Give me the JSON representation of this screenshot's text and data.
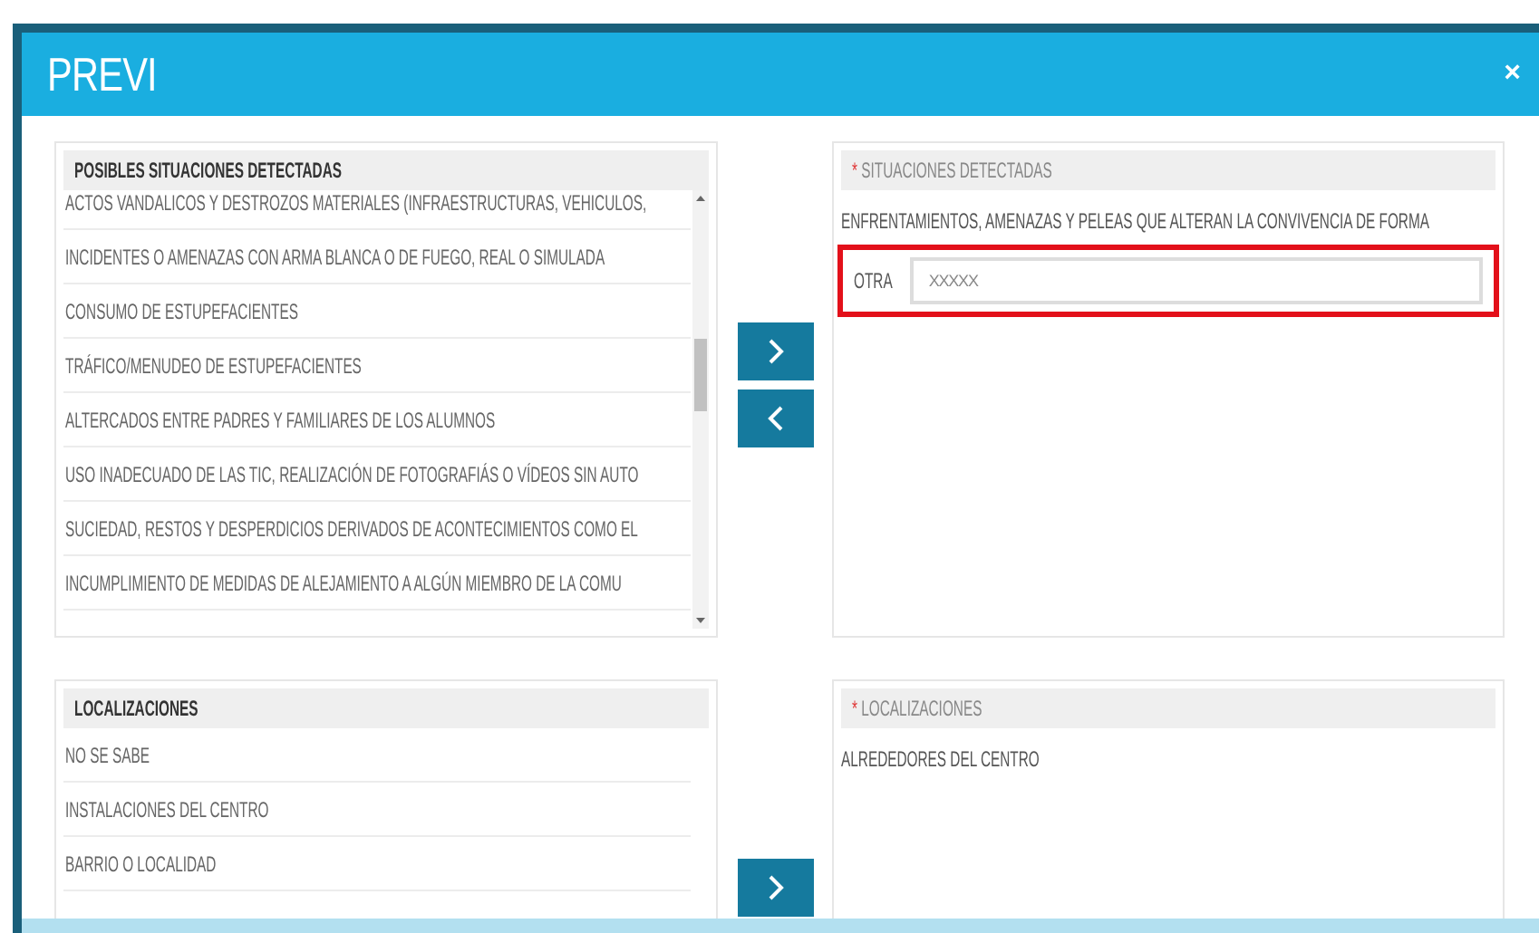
{
  "dialog": {
    "title": "PREVI",
    "close": "×"
  },
  "sections": [
    {
      "available": {
        "header": "POSIBLES SITUACIONES DETECTADAS",
        "scrollable": true,
        "items": [
          "ACTOS VANDALICOS Y DESTROZOS MATERIALES (INFRAESTRUCTURAS, VEHICULOS,",
          "INCIDENTES O AMENAZAS CON ARMA BLANCA O DE FUEGO, REAL O SIMULADA",
          "CONSUMO DE ESTUPEFACIENTES",
          "TRÁFICO/MENUDEO DE ESTUPEFACIENTES",
          "ALTERCADOS ENTRE PADRES Y FAMILIARES DE LOS ALUMNOS",
          "USO INADECUADO DE LAS TIC, REALIZACIÓN DE FOTOGRAFIÁS O VÍDEOS SIN AUTO",
          "SUCIEDAD, RESTOS Y DESPERDICIOS DERIVADOS DE ACONTECIMIENTOS COMO EL",
          "INCUMPLIMIENTO DE MEDIDAS DE ALEJAMIENTO A ALGÚN MIEMBRO DE LA COMU"
        ]
      },
      "buttons": [
        {
          "kind": "add"
        },
        {
          "kind": "remove"
        }
      ],
      "chosen": {
        "header": "SITUACIONES DETECTADAS",
        "required_mark": "*",
        "items": [
          "ENFRENTAMIENTOS, AMENAZAS Y PELEAS QUE ALTERAN LA CONVIVENCIA DE FORMA"
        ],
        "other": {
          "label": "OTRA",
          "value": "XXXXX",
          "highlighted": true
        }
      }
    },
    {
      "available": {
        "header": "LOCALIZACIONES",
        "scrollable": false,
        "items": [
          "NO SE SABE",
          "INSTALACIONES DEL CENTRO",
          "BARRIO O LOCALIDAD"
        ]
      },
      "buttons": [
        {
          "kind": "add"
        }
      ],
      "chosen": {
        "header": "LOCALIZACIONES",
        "required_mark": "*",
        "items": [
          "ALREDEDORES DEL CENTRO"
        ]
      }
    }
  ]
}
